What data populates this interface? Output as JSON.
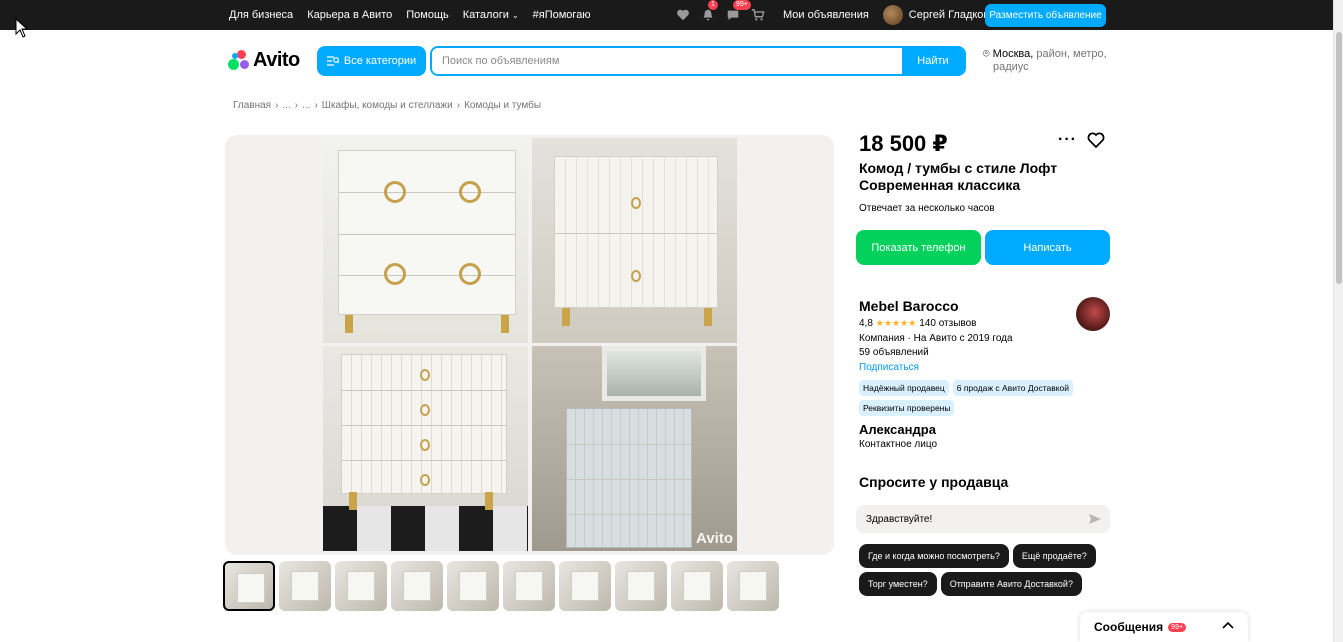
{
  "topbar": {
    "links": [
      "Для бизнеса",
      "Карьера в Авито",
      "Помощь",
      "Каталоги",
      "#яПомогаю"
    ],
    "notifications_badge": "1",
    "messages_badge": "99+",
    "my_ads": "Мои объявления",
    "user_name": "Сергей Гладков",
    "post_button": "Разместить объявление"
  },
  "header": {
    "logo": "Avito",
    "all_categories": "Все категории",
    "search_placeholder": "Поиск по объявлениям",
    "search_button": "Найти",
    "location_city": "Москва,",
    "location_rest": "район, метро,",
    "location_rest2": "радиус"
  },
  "breadcrumb": [
    "Главная",
    "...",
    "...",
    "Шкафы, комоды и стеллажи",
    "Комоды и тумбы"
  ],
  "gallery": {
    "watermark": "Avito",
    "thumb_count": 10
  },
  "listing": {
    "price": "18 500 ₽",
    "title": "Комод / тумбы с стиле Лофт Современная классика",
    "reply_time": "Отвечает за несколько часов",
    "show_phone": "Показать телефон",
    "write": "Написать"
  },
  "seller": {
    "name": "Mebel Barocco",
    "rating": "4,8",
    "stars": "★★★★★",
    "reviews": "140 отзывов",
    "company_info": "Компания · На Авито с 2019 года",
    "ads_count": "59 объявлений",
    "subscribe": "Подписаться",
    "badges": [
      "Надёжный продавец",
      "6 продаж с Авито Доставкой",
      "Реквизиты проверены"
    ],
    "contact_name": "Александра",
    "contact_role": "Контактное лицо"
  },
  "ask": {
    "title": "Спросите у продавца",
    "input_value": "Здравствуйте!",
    "chips": [
      "Где и когда можно посмотреть?",
      "Ещё продаёте?",
      "Торг уместен?",
      "Отправите Авито Доставкой?"
    ]
  },
  "messages_widget": {
    "label": "Сообщения",
    "badge": "99+"
  },
  "colors": {
    "accent": "#00aaff",
    "phone_green": "#02d15c",
    "badge_red": "#ff4053",
    "topbar": "#1a1a1a"
  }
}
